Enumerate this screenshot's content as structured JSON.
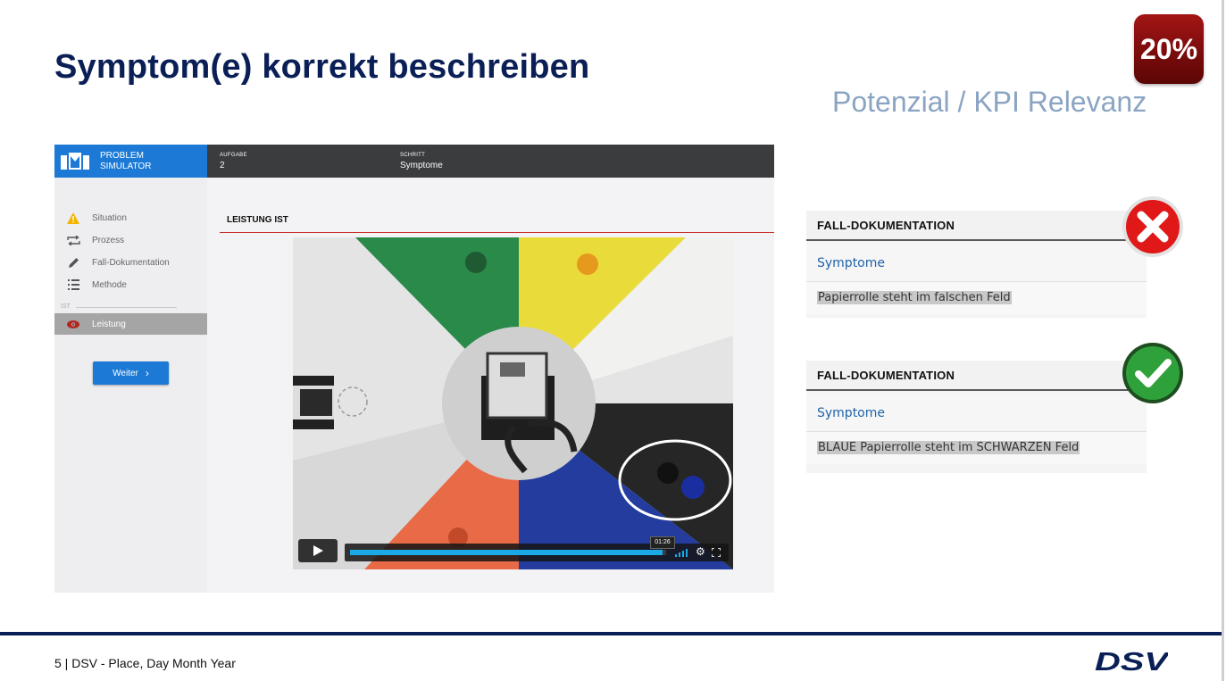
{
  "slide": {
    "title": "Symptom(e) korrekt beschreiben",
    "badge": "20%",
    "kpi_label": "Potenzial / KPI Relevanz",
    "footer": "5 | DSV - Place, Day Month Year"
  },
  "app": {
    "brand_line1": "PROBLEM",
    "brand_line2": "SIMULATOR",
    "aufgabe_label": "AUFGABE",
    "aufgabe_value": "2",
    "schritt_label": "SCHRITT",
    "schritt_value": "Symptome",
    "nav": [
      {
        "label": "Situation",
        "icon": "warning-icon"
      },
      {
        "label": "Prozess",
        "icon": "repeat-icon"
      },
      {
        "label": "Fall-Dokumentation",
        "icon": "pencil-icon"
      },
      {
        "label": "Methode",
        "icon": "list-icon"
      }
    ],
    "ist_label": "IST",
    "active_item": {
      "label": "Leistung",
      "icon": "eye-icon"
    },
    "weiter_label": "Weiter",
    "section_title": "LEISTUNG IST",
    "video": {
      "time": "01:26",
      "progress": 0.99
    }
  },
  "cards": [
    {
      "header": "FALL-DOKUMENTATION",
      "field": "Symptome",
      "value": "Papierrolle steht im falschen Feld",
      "verdict": "wrong"
    },
    {
      "header": "FALL-DOKUMENTATION",
      "field": "Symptome",
      "value": "BLAUE Papierrolle steht im SCHWARZEN Feld",
      "verdict": "correct"
    }
  ],
  "colors": {
    "navy": "#0a1f56",
    "accent_blue": "#1c7ad6",
    "badge_red": "#a31515",
    "kpi_blue": "#8aa4c2"
  }
}
